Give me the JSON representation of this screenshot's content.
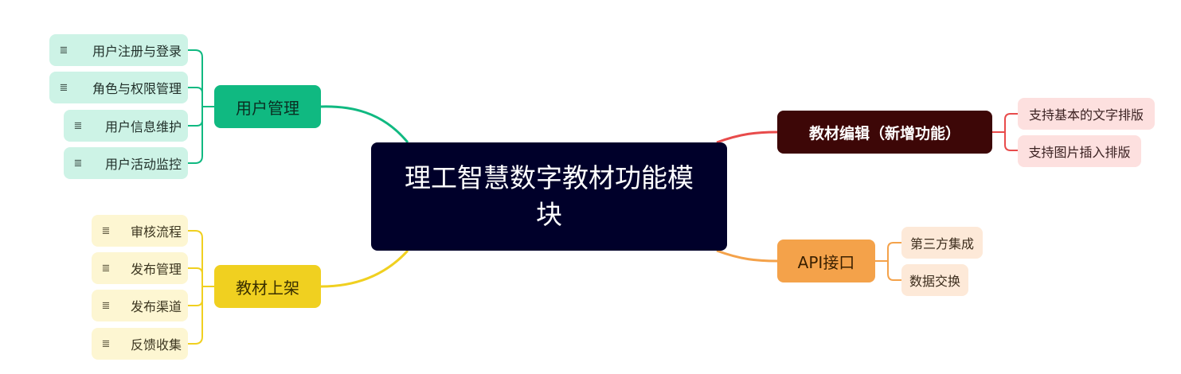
{
  "root": {
    "title": "理工智慧数字教材功能模块"
  },
  "branches": {
    "user": {
      "label": "用户管理",
      "color": "#10b981",
      "children": [
        "用户注册与登录",
        "角色与权限管理",
        "用户信息维护",
        "用户活动监控"
      ]
    },
    "shelf": {
      "label": "教材上架",
      "color": "#f0d020",
      "children": [
        "审核流程",
        "发布管理",
        "发布渠道",
        "反馈收集"
      ]
    },
    "edit": {
      "label": "教材编辑（新增功能）",
      "color": "#3d0707",
      "children": [
        "支持基本的文字排版",
        "支持图片插入排版"
      ]
    },
    "api": {
      "label": "API接口",
      "color": "#f4a24a",
      "children": [
        "第三方集成",
        "数据交换"
      ]
    }
  },
  "icons": {
    "note": "note-icon"
  }
}
